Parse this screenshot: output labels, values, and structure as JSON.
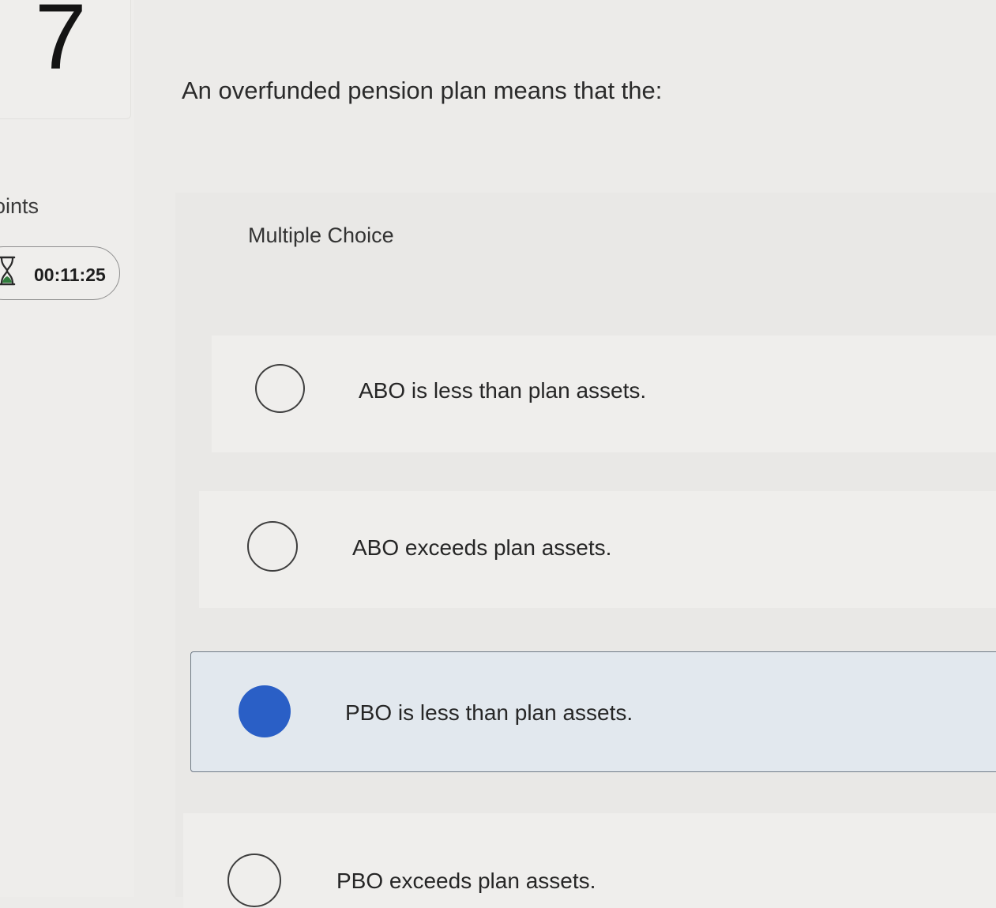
{
  "question": {
    "number": "7",
    "points_label": "oints",
    "timer": "00:11:25",
    "prompt": "An overfunded pension plan means that the:",
    "type_label": "Multiple Choice"
  },
  "options": [
    {
      "label": "ABO is less than plan assets.",
      "selected": false
    },
    {
      "label": "ABO exceeds plan assets.",
      "selected": false
    },
    {
      "label": "PBO is less than plan assets.",
      "selected": true
    },
    {
      "label": "PBO exceeds plan assets.",
      "selected": false
    }
  ],
  "colors": {
    "selected_radio": "#2a5fc6",
    "selected_option_bg": "#e2e8ee"
  }
}
